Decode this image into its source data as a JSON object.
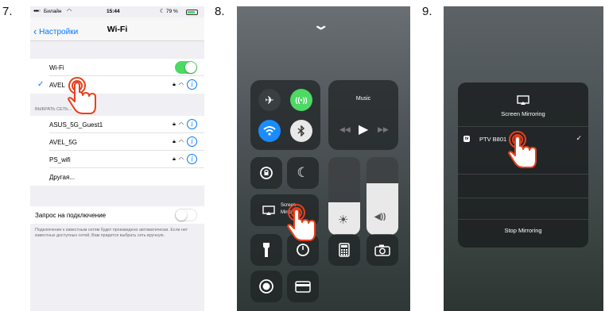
{
  "steps": [
    "7.",
    "8.",
    "9."
  ],
  "settings": {
    "carrier": "Билайн",
    "time": "15:44",
    "battery": "79 %",
    "back_label": "Настройки",
    "title": "Wi-Fi",
    "wifi_label": "Wi-Fi",
    "wifi_on": true,
    "connected_network": "AVEL",
    "choose_network_header": "ВЫБРАТЬ СЕТЬ...",
    "networks": [
      "ASUS_5G_Guest1",
      "AVEL_5G",
      "PS_wifi"
    ],
    "other_label": "Другая...",
    "ask_to_join_label": "Запрос на подключение",
    "ask_to_join_on": false,
    "footnote": "Подключение к известным сетям будет произведено автоматически. Если нет известных доступных сетей, Вам придется выбрать сеть вручную.",
    "accent_color": "#007aff",
    "toggle_on_color": "#4cd964"
  },
  "control_center": {
    "music_label": "Music",
    "mirroring_label_line1": "Screen",
    "mirroring_label_line2": "Mirroring",
    "airplane_color": "#3a3f42",
    "cellular_color": "#4cd964",
    "wifi_color": "#1a8cff",
    "bluetooth_color": "#e8e8e8",
    "brightness_level": 0.42,
    "volume_level": 0.66
  },
  "mirroring": {
    "title": "Screen Mirroring",
    "device_badge": "tv",
    "device_name": "PTV B801",
    "stop_label": "Stop Mirroring"
  }
}
